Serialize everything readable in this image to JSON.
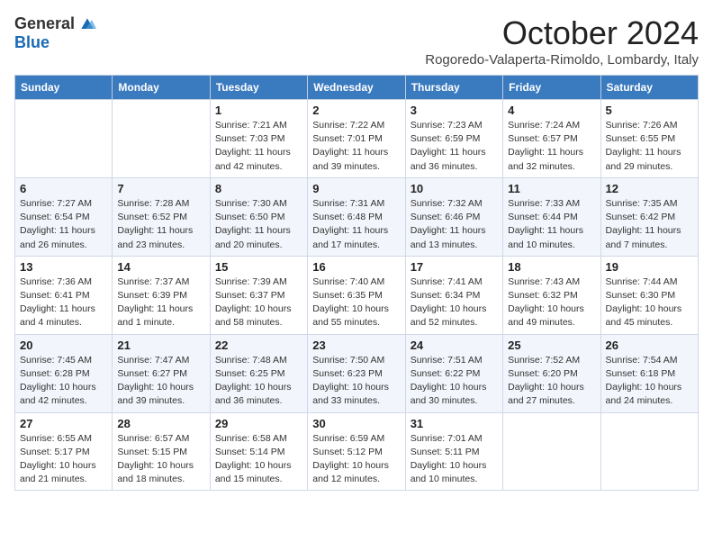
{
  "header": {
    "logo_general": "General",
    "logo_blue": "Blue",
    "month_title": "October 2024",
    "subtitle": "Rogoredo-Valaperta-Rimoldo, Lombardy, Italy"
  },
  "days_of_week": [
    "Sunday",
    "Monday",
    "Tuesday",
    "Wednesday",
    "Thursday",
    "Friday",
    "Saturday"
  ],
  "weeks": [
    [
      {
        "day": "",
        "info": ""
      },
      {
        "day": "",
        "info": ""
      },
      {
        "day": "1",
        "info": "Sunrise: 7:21 AM\nSunset: 7:03 PM\nDaylight: 11 hours and 42 minutes."
      },
      {
        "day": "2",
        "info": "Sunrise: 7:22 AM\nSunset: 7:01 PM\nDaylight: 11 hours and 39 minutes."
      },
      {
        "day": "3",
        "info": "Sunrise: 7:23 AM\nSunset: 6:59 PM\nDaylight: 11 hours and 36 minutes."
      },
      {
        "day": "4",
        "info": "Sunrise: 7:24 AM\nSunset: 6:57 PM\nDaylight: 11 hours and 32 minutes."
      },
      {
        "day": "5",
        "info": "Sunrise: 7:26 AM\nSunset: 6:55 PM\nDaylight: 11 hours and 29 minutes."
      }
    ],
    [
      {
        "day": "6",
        "info": "Sunrise: 7:27 AM\nSunset: 6:54 PM\nDaylight: 11 hours and 26 minutes."
      },
      {
        "day": "7",
        "info": "Sunrise: 7:28 AM\nSunset: 6:52 PM\nDaylight: 11 hours and 23 minutes."
      },
      {
        "day": "8",
        "info": "Sunrise: 7:30 AM\nSunset: 6:50 PM\nDaylight: 11 hours and 20 minutes."
      },
      {
        "day": "9",
        "info": "Sunrise: 7:31 AM\nSunset: 6:48 PM\nDaylight: 11 hours and 17 minutes."
      },
      {
        "day": "10",
        "info": "Sunrise: 7:32 AM\nSunset: 6:46 PM\nDaylight: 11 hours and 13 minutes."
      },
      {
        "day": "11",
        "info": "Sunrise: 7:33 AM\nSunset: 6:44 PM\nDaylight: 11 hours and 10 minutes."
      },
      {
        "day": "12",
        "info": "Sunrise: 7:35 AM\nSunset: 6:42 PM\nDaylight: 11 hours and 7 minutes."
      }
    ],
    [
      {
        "day": "13",
        "info": "Sunrise: 7:36 AM\nSunset: 6:41 PM\nDaylight: 11 hours and 4 minutes."
      },
      {
        "day": "14",
        "info": "Sunrise: 7:37 AM\nSunset: 6:39 PM\nDaylight: 11 hours and 1 minute."
      },
      {
        "day": "15",
        "info": "Sunrise: 7:39 AM\nSunset: 6:37 PM\nDaylight: 10 hours and 58 minutes."
      },
      {
        "day": "16",
        "info": "Sunrise: 7:40 AM\nSunset: 6:35 PM\nDaylight: 10 hours and 55 minutes."
      },
      {
        "day": "17",
        "info": "Sunrise: 7:41 AM\nSunset: 6:34 PM\nDaylight: 10 hours and 52 minutes."
      },
      {
        "day": "18",
        "info": "Sunrise: 7:43 AM\nSunset: 6:32 PM\nDaylight: 10 hours and 49 minutes."
      },
      {
        "day": "19",
        "info": "Sunrise: 7:44 AM\nSunset: 6:30 PM\nDaylight: 10 hours and 45 minutes."
      }
    ],
    [
      {
        "day": "20",
        "info": "Sunrise: 7:45 AM\nSunset: 6:28 PM\nDaylight: 10 hours and 42 minutes."
      },
      {
        "day": "21",
        "info": "Sunrise: 7:47 AM\nSunset: 6:27 PM\nDaylight: 10 hours and 39 minutes."
      },
      {
        "day": "22",
        "info": "Sunrise: 7:48 AM\nSunset: 6:25 PM\nDaylight: 10 hours and 36 minutes."
      },
      {
        "day": "23",
        "info": "Sunrise: 7:50 AM\nSunset: 6:23 PM\nDaylight: 10 hours and 33 minutes."
      },
      {
        "day": "24",
        "info": "Sunrise: 7:51 AM\nSunset: 6:22 PM\nDaylight: 10 hours and 30 minutes."
      },
      {
        "day": "25",
        "info": "Sunrise: 7:52 AM\nSunset: 6:20 PM\nDaylight: 10 hours and 27 minutes."
      },
      {
        "day": "26",
        "info": "Sunrise: 7:54 AM\nSunset: 6:18 PM\nDaylight: 10 hours and 24 minutes."
      }
    ],
    [
      {
        "day": "27",
        "info": "Sunrise: 6:55 AM\nSunset: 5:17 PM\nDaylight: 10 hours and 21 minutes."
      },
      {
        "day": "28",
        "info": "Sunrise: 6:57 AM\nSunset: 5:15 PM\nDaylight: 10 hours and 18 minutes."
      },
      {
        "day": "29",
        "info": "Sunrise: 6:58 AM\nSunset: 5:14 PM\nDaylight: 10 hours and 15 minutes."
      },
      {
        "day": "30",
        "info": "Sunrise: 6:59 AM\nSunset: 5:12 PM\nDaylight: 10 hours and 12 minutes."
      },
      {
        "day": "31",
        "info": "Sunrise: 7:01 AM\nSunset: 5:11 PM\nDaylight: 10 hours and 10 minutes."
      },
      {
        "day": "",
        "info": ""
      },
      {
        "day": "",
        "info": ""
      }
    ]
  ]
}
